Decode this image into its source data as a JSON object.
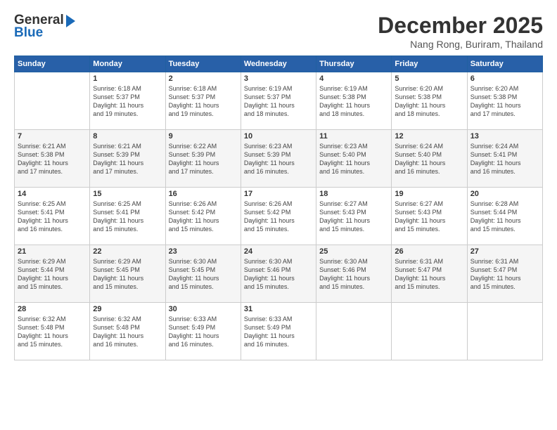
{
  "logo": {
    "line1": "General",
    "line2": "Blue"
  },
  "title": "December 2025",
  "location": "Nang Rong, Buriram, Thailand",
  "days_header": [
    "Sunday",
    "Monday",
    "Tuesday",
    "Wednesday",
    "Thursday",
    "Friday",
    "Saturday"
  ],
  "weeks": [
    [
      {
        "day": "",
        "info": ""
      },
      {
        "day": "1",
        "info": "Sunrise: 6:18 AM\nSunset: 5:37 PM\nDaylight: 11 hours\nand 19 minutes."
      },
      {
        "day": "2",
        "info": "Sunrise: 6:18 AM\nSunset: 5:37 PM\nDaylight: 11 hours\nand 19 minutes."
      },
      {
        "day": "3",
        "info": "Sunrise: 6:19 AM\nSunset: 5:37 PM\nDaylight: 11 hours\nand 18 minutes."
      },
      {
        "day": "4",
        "info": "Sunrise: 6:19 AM\nSunset: 5:38 PM\nDaylight: 11 hours\nand 18 minutes."
      },
      {
        "day": "5",
        "info": "Sunrise: 6:20 AM\nSunset: 5:38 PM\nDaylight: 11 hours\nand 18 minutes."
      },
      {
        "day": "6",
        "info": "Sunrise: 6:20 AM\nSunset: 5:38 PM\nDaylight: 11 hours\nand 17 minutes."
      }
    ],
    [
      {
        "day": "7",
        "info": "Sunrise: 6:21 AM\nSunset: 5:38 PM\nDaylight: 11 hours\nand 17 minutes."
      },
      {
        "day": "8",
        "info": "Sunrise: 6:21 AM\nSunset: 5:39 PM\nDaylight: 11 hours\nand 17 minutes."
      },
      {
        "day": "9",
        "info": "Sunrise: 6:22 AM\nSunset: 5:39 PM\nDaylight: 11 hours\nand 17 minutes."
      },
      {
        "day": "10",
        "info": "Sunrise: 6:23 AM\nSunset: 5:39 PM\nDaylight: 11 hours\nand 16 minutes."
      },
      {
        "day": "11",
        "info": "Sunrise: 6:23 AM\nSunset: 5:40 PM\nDaylight: 11 hours\nand 16 minutes."
      },
      {
        "day": "12",
        "info": "Sunrise: 6:24 AM\nSunset: 5:40 PM\nDaylight: 11 hours\nand 16 minutes."
      },
      {
        "day": "13",
        "info": "Sunrise: 6:24 AM\nSunset: 5:41 PM\nDaylight: 11 hours\nand 16 minutes."
      }
    ],
    [
      {
        "day": "14",
        "info": "Sunrise: 6:25 AM\nSunset: 5:41 PM\nDaylight: 11 hours\nand 16 minutes."
      },
      {
        "day": "15",
        "info": "Sunrise: 6:25 AM\nSunset: 5:41 PM\nDaylight: 11 hours\nand 15 minutes."
      },
      {
        "day": "16",
        "info": "Sunrise: 6:26 AM\nSunset: 5:42 PM\nDaylight: 11 hours\nand 15 minutes."
      },
      {
        "day": "17",
        "info": "Sunrise: 6:26 AM\nSunset: 5:42 PM\nDaylight: 11 hours\nand 15 minutes."
      },
      {
        "day": "18",
        "info": "Sunrise: 6:27 AM\nSunset: 5:43 PM\nDaylight: 11 hours\nand 15 minutes."
      },
      {
        "day": "19",
        "info": "Sunrise: 6:27 AM\nSunset: 5:43 PM\nDaylight: 11 hours\nand 15 minutes."
      },
      {
        "day": "20",
        "info": "Sunrise: 6:28 AM\nSunset: 5:44 PM\nDaylight: 11 hours\nand 15 minutes."
      }
    ],
    [
      {
        "day": "21",
        "info": "Sunrise: 6:29 AM\nSunset: 5:44 PM\nDaylight: 11 hours\nand 15 minutes."
      },
      {
        "day": "22",
        "info": "Sunrise: 6:29 AM\nSunset: 5:45 PM\nDaylight: 11 hours\nand 15 minutes."
      },
      {
        "day": "23",
        "info": "Sunrise: 6:30 AM\nSunset: 5:45 PM\nDaylight: 11 hours\nand 15 minutes."
      },
      {
        "day": "24",
        "info": "Sunrise: 6:30 AM\nSunset: 5:46 PM\nDaylight: 11 hours\nand 15 minutes."
      },
      {
        "day": "25",
        "info": "Sunrise: 6:30 AM\nSunset: 5:46 PM\nDaylight: 11 hours\nand 15 minutes."
      },
      {
        "day": "26",
        "info": "Sunrise: 6:31 AM\nSunset: 5:47 PM\nDaylight: 11 hours\nand 15 minutes."
      },
      {
        "day": "27",
        "info": "Sunrise: 6:31 AM\nSunset: 5:47 PM\nDaylight: 11 hours\nand 15 minutes."
      }
    ],
    [
      {
        "day": "28",
        "info": "Sunrise: 6:32 AM\nSunset: 5:48 PM\nDaylight: 11 hours\nand 15 minutes."
      },
      {
        "day": "29",
        "info": "Sunrise: 6:32 AM\nSunset: 5:48 PM\nDaylight: 11 hours\nand 16 minutes."
      },
      {
        "day": "30",
        "info": "Sunrise: 6:33 AM\nSunset: 5:49 PM\nDaylight: 11 hours\nand 16 minutes."
      },
      {
        "day": "31",
        "info": "Sunrise: 6:33 AM\nSunset: 5:49 PM\nDaylight: 11 hours\nand 16 minutes."
      },
      {
        "day": "",
        "info": ""
      },
      {
        "day": "",
        "info": ""
      },
      {
        "day": "",
        "info": ""
      }
    ]
  ]
}
